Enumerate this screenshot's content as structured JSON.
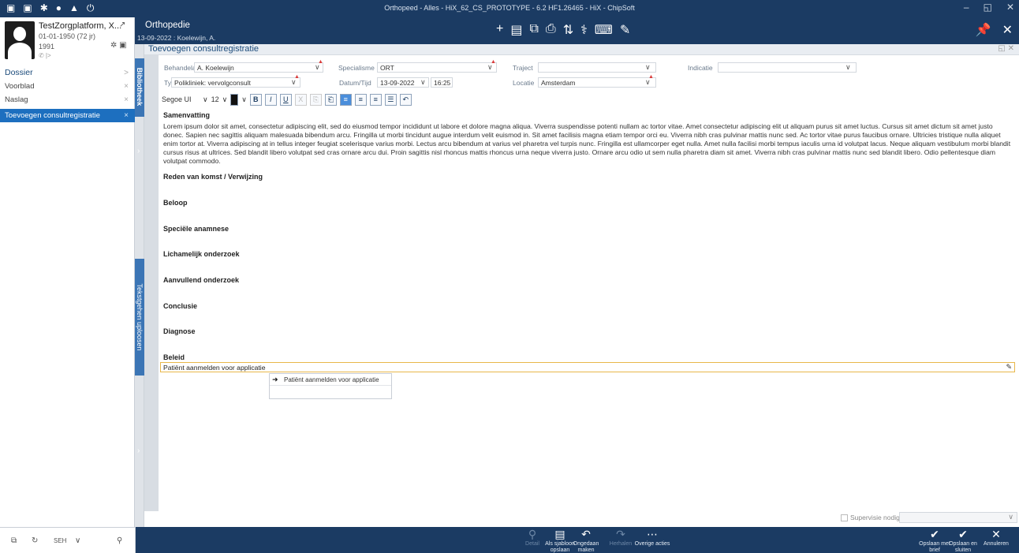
{
  "titlebar": {
    "title": "Orthopeed - Alles - HiX_62_CS_PROTOTYPE - 6.2 HF1.26465 - HiX - ChipSoft",
    "icons": [
      "▣",
      "▣",
      "✱",
      "●",
      "▲",
      "⏻"
    ],
    "minimize": "–",
    "maximize": "◱",
    "close": "✕"
  },
  "patient": {
    "name": "TestZorgplatform, X...",
    "link_icon": "↗",
    "dob": "01-01-1950 (72 jr)",
    "id": "1991",
    "flags": "✲ ▣",
    "contact": "✆ |>"
  },
  "sidebar": {
    "items": [
      {
        "label": "Dossier",
        "right": ">"
      },
      {
        "label": "Voorblad",
        "right": "×"
      },
      {
        "label": "Naslag",
        "right": "×"
      },
      {
        "label": "Toevoegen consultregistratie",
        "right": "×"
      }
    ],
    "footer": {
      "icon1": "⧉",
      "icon2": "↻",
      "dept": "SEH",
      "chev": "∨",
      "search": "⚲"
    }
  },
  "context": {
    "title": "Orthopedie",
    "subtitle": "13-09-2022 : Koelewijn, A.",
    "tools": [
      "+",
      "▤",
      "⧉",
      "⎙",
      "⇅",
      "⚕",
      "⌨",
      "✎"
    ],
    "pin": "📌",
    "close": "✕"
  },
  "panel": {
    "title": "Toevoegen consultregistratie",
    "ctrls": "◱  ✕",
    "library_tab": "Bibliotheek",
    "text_tab": "Tekstgehen uploosen"
  },
  "form": {
    "behandelaar_label": "Behandelaar",
    "behandelaar_value": "A. Koelewijn",
    "specialisme_label": "Specialisme",
    "specialisme_value": "ORT",
    "traject_label": "Traject",
    "indicatie_label": "Indicatie",
    "type_label": "Type",
    "type_value": "Polikliniek: vervolgconsult",
    "datum_label": "Datum/Tijd",
    "datum_value": "13-09-2022",
    "tijd_value": "16:25",
    "locatie_label": "Locatie",
    "locatie_value": "Amsterdam"
  },
  "editor_toolbar": {
    "font": "Segoe UI",
    "size": "12",
    "buttons": [
      "B",
      "I",
      "U",
      "X",
      "⎘",
      "⎗",
      "≡",
      "≡",
      "≡",
      "☰",
      "↶"
    ]
  },
  "sections": {
    "samenvatting": "Samenvatting",
    "reden": "Reden van komst / Verwijzing",
    "beloop": "Beloop",
    "speciele": "Speciële anamnese",
    "lichamelijk": "Lichamelijk onderzoek",
    "aanvullend": "Aanvullend onderzoek",
    "conclusie": "Conclusie",
    "diagnose": "Diagnose",
    "beleid": "Beleid"
  },
  "lorem": "Lorem ipsum dolor sit amet, consectetur adipiscing elit, sed do eiusmod tempor incididunt ut labore et dolore magna aliqua. Viverra suspendisse potenti nullam ac tortor vitae. Amet consectetur adipiscing elit ut aliquam purus sit amet luctus. Cursus sit amet dictum sit amet justo donec. Sapien nec sagittis aliquam malesuada bibendum arcu. Fringilla ut morbi tincidunt augue interdum velit euismod in. Sit amet facilisis magna etiam tempor orci eu. Viverra nibh cras pulvinar mattis nunc sed. Ac tortor vitae purus faucibus ornare. Ultricies tristique nulla aliquet enim tortor at. Viverra adipiscing at in tellus integer feugiat scelerisque varius morbi. Lectus arcu bibendum at varius vel pharetra vel turpis nunc. Fringilla est ullamcorper eget nulla. Amet nulla facilisi morbi tempus iaculis urna id volutpat lacus. Neque aliquam vestibulum morbi blandit cursus risus at ultrices. Sed blandit libero volutpat sed cras ornare arcu dui. Proin sagittis nisl rhoncus mattis rhoncus urna neque viverra justo. Ornare arcu odio ut sem nulla pharetra diam sit amet. Viverra nibh cras pulvinar mattis nunc sed blandit libero. Odio pellentesque diam volutpat commodo.",
  "beleid_input": "Patiënt aanmelden voor applicatie",
  "suggestion": "Patiënt aanmelden voor applicatie",
  "supervisie_label": "Supervisie nodig door:",
  "bottom": {
    "detail": "Detail",
    "sjabloon": "Als sjabloon opslaan",
    "ongedaan": "Ongedaan maken",
    "herhalen": "Herhalen",
    "overige": "Overige acties",
    "opslaan_brief": "Opslaan met brief",
    "opslaan_sluiten": "Opslaan en sluiten",
    "annuleren": "Annuleren"
  }
}
